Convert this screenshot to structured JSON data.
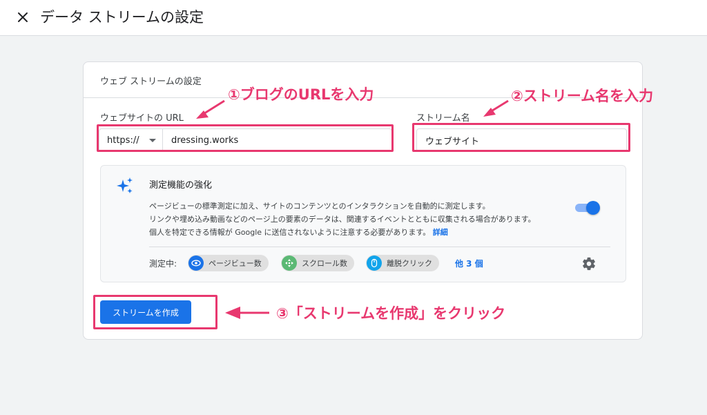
{
  "header": {
    "title": "データ ストリームの設定"
  },
  "card": {
    "title": "ウェブ ストリームの設定",
    "url_label": "ウェブサイトの URL",
    "protocol": "https://",
    "url_value": "dressing.works",
    "stream_name_label": "ストリーム名",
    "stream_name_value": "ウェブサイト"
  },
  "enhanced": {
    "title": "測定機能の強化",
    "desc_line1": "ページビューの標準測定に加え、サイトのコンテンツとのインタラクションを自動的に測定します。",
    "desc_line2": "リンクや埋め込み動画などのページ上の要素のデータは、関連するイベントとともに収集される場合があります。",
    "desc_line3": "個人を特定できる情報が Google に送信されないように注意する必要があります。",
    "details_link": "詳細",
    "toggle_on": true,
    "measuring_label": "測定中:",
    "chips": [
      {
        "label": "ページビュー数",
        "icon": "eye-icon",
        "color": "#1a73e8"
      },
      {
        "label": "スクロール数",
        "icon": "scroll-icon",
        "color": "#5bb974"
      },
      {
        "label": "離脱クリック",
        "icon": "mouse-icon",
        "color": "#12a4eb"
      }
    ],
    "more": "他 3 個"
  },
  "create_button": "ストリームを作成",
  "annotations": {
    "a1": "①ブログのURLを入力",
    "a2": "②ストリーム名を入力",
    "a3": "③「ストリームを作成」をクリック",
    "color": "#e8386f"
  }
}
